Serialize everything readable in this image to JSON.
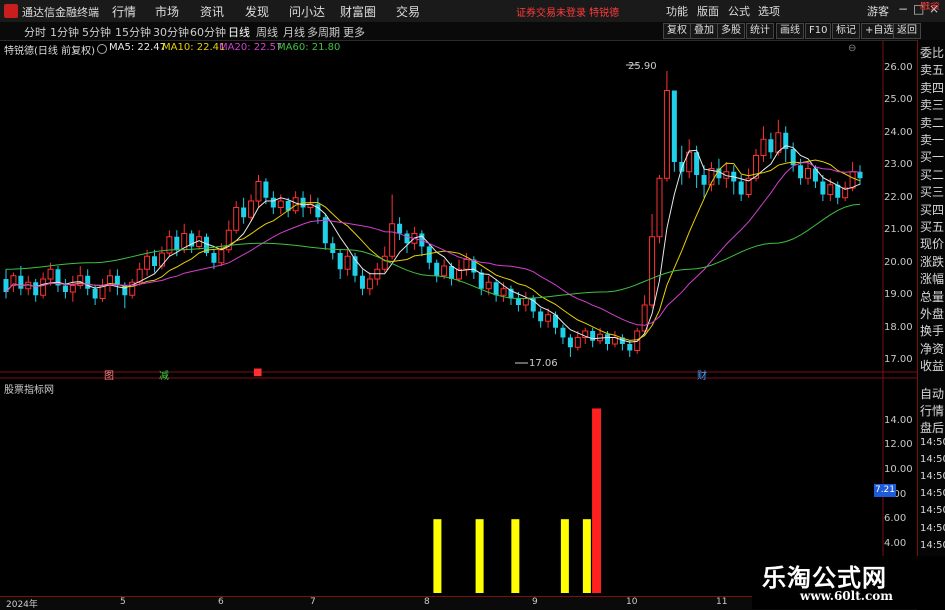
{
  "app": {
    "title": "通达信金融终端"
  },
  "menu": [
    "行情",
    "市场",
    "资讯",
    "发现",
    "问小达",
    "财富圈",
    "交易"
  ],
  "notice": "证券交易未登录 特锐德",
  "right_menu": [
    "功能",
    "版面",
    "公式",
    "选项"
  ],
  "guest_label": "游客",
  "window_buttons": {
    "minimize": "−",
    "maximize": "□",
    "close": "×"
  },
  "timeframes": [
    "分时",
    "1分钟",
    "5分钟",
    "15分钟",
    "30分钟",
    "60分钟",
    "日线",
    "周线",
    "月线",
    "多周期",
    "更多"
  ],
  "active_timeframe": "日线",
  "right_toolbar": [
    "复权",
    "叠加",
    "多股",
    "统计",
    "画线",
    "F10",
    "标记",
    "+自选",
    "返回"
  ],
  "legend": {
    "stock": "特锐德(日线 前复权)",
    "ma5": "MA5: 22.47",
    "ma10": "MA10: 22.41",
    "ma20": "MA20: 22.57",
    "ma60": "MA60: 21.80"
  },
  "colors": {
    "up": "#ff3030",
    "down": "#20d0e8",
    "ma5": "#e8e8e8",
    "ma10": "#e8d000",
    "ma20": "#d040d0",
    "ma60": "#40c040",
    "signal": "#ffff00",
    "highlight": "#ff2020",
    "frame": "#7a1010"
  },
  "price_axis": [
    "26.00",
    "25.00",
    "24.00",
    "23.00",
    "22.00",
    "21.00",
    "20.00",
    "19.00",
    "18.00",
    "17.00"
  ],
  "price_marks": {
    "high": "25.90",
    "low": "17.06"
  },
  "event_marks": [
    {
      "label": "图",
      "color": "#ff8080"
    },
    {
      "label": "减",
      "color": "#40d040"
    },
    {
      "label": "■",
      "color": "#ff3030"
    },
    {
      "label": "财",
      "color": "#40a0ff"
    }
  ],
  "indicator": {
    "title": "股票指标网",
    "axis": [
      "14.00",
      "12.00",
      "10.00",
      "8.00",
      "6.00",
      "4.00"
    ],
    "current": "7.21"
  },
  "x_axis": [
    "2024年",
    "5",
    "6",
    "7",
    "8",
    "9",
    "10",
    "11"
  ],
  "right_sidebar": {
    "top": [
      "委比",
      "卖五",
      "卖四",
      "卖三",
      "卖二",
      "卖一",
      "买一",
      "买二",
      "买三",
      "买四",
      "买五",
      "现价",
      "涨跌",
      "涨幅",
      "总量",
      "外盘",
      "换手",
      "净资",
      "收益"
    ],
    "bottom": [
      "自动",
      "行情",
      "盘后",
      "14:50",
      "14:50",
      "14:50",
      "14:50",
      "14:50",
      "14:50",
      "14:50",
      "14:50",
      "14:50"
    ],
    "small_red": "融资"
  },
  "watermark": {
    "cn": "乐淘公式网",
    "url": "www.60lt.com"
  },
  "chart_data": {
    "type": "candlestick",
    "y_range": [
      16.7,
      26.3
    ],
    "candles": [
      [
        19.5,
        19.1,
        19.8,
        18.9
      ],
      [
        19.3,
        19.6,
        19.7,
        19.1
      ],
      [
        19.6,
        19.2,
        19.9,
        19.0
      ],
      [
        19.2,
        19.4,
        19.6,
        19.0
      ],
      [
        19.4,
        19.0,
        19.5,
        18.8
      ],
      [
        19.0,
        19.5,
        19.7,
        18.9
      ],
      [
        19.5,
        19.8,
        20.0,
        19.3
      ],
      [
        19.8,
        19.3,
        19.9,
        19.1
      ],
      [
        19.3,
        19.1,
        19.5,
        18.9
      ],
      [
        19.1,
        19.3,
        19.6,
        18.8
      ],
      [
        19.3,
        19.6,
        19.9,
        19.2
      ],
      [
        19.6,
        19.2,
        19.8,
        19.0
      ],
      [
        19.2,
        18.9,
        19.3,
        18.7
      ],
      [
        18.9,
        19.3,
        19.5,
        18.8
      ],
      [
        19.3,
        19.6,
        19.8,
        19.1
      ],
      [
        19.6,
        19.3,
        19.8,
        19.0
      ],
      [
        19.3,
        19.0,
        19.4,
        18.6
      ],
      [
        19.0,
        19.4,
        19.5,
        18.9
      ],
      [
        19.4,
        19.8,
        20.0,
        19.3
      ],
      [
        19.8,
        20.2,
        20.4,
        19.6
      ],
      [
        20.2,
        19.9,
        20.4,
        19.7
      ],
      [
        19.9,
        20.3,
        20.5,
        19.8
      ],
      [
        20.3,
        20.8,
        21.0,
        20.2
      ],
      [
        20.8,
        20.4,
        21.0,
        20.2
      ],
      [
        20.4,
        20.9,
        21.2,
        20.3
      ],
      [
        20.9,
        20.5,
        21.0,
        20.3
      ],
      [
        20.5,
        20.8,
        21.0,
        20.4
      ],
      [
        20.8,
        20.3,
        20.9,
        20.2
      ],
      [
        20.3,
        20.0,
        20.4,
        19.8
      ],
      [
        20.0,
        20.4,
        20.6,
        19.9
      ],
      [
        20.4,
        21.0,
        21.3,
        20.3
      ],
      [
        21.0,
        21.7,
        21.9,
        20.9
      ],
      [
        21.7,
        21.4,
        22.0,
        21.2
      ],
      [
        21.4,
        21.9,
        22.1,
        21.3
      ],
      [
        21.9,
        22.5,
        22.7,
        21.7
      ],
      [
        22.5,
        22.0,
        22.6,
        21.8
      ],
      [
        22.0,
        21.7,
        22.2,
        21.5
      ],
      [
        21.7,
        21.9,
        22.1,
        21.5
      ],
      [
        21.9,
        21.6,
        22.0,
        21.4
      ],
      [
        21.6,
        22.0,
        22.2,
        21.5
      ],
      [
        22.0,
        21.7,
        22.2,
        21.4
      ],
      [
        21.7,
        21.8,
        22.1,
        21.5
      ],
      [
        21.8,
        21.4,
        22.0,
        21.2
      ],
      [
        21.4,
        20.6,
        21.5,
        20.4
      ],
      [
        20.6,
        20.3,
        20.8,
        20.1
      ],
      [
        20.3,
        19.8,
        20.4,
        19.5
      ],
      [
        19.8,
        20.2,
        20.4,
        19.6
      ],
      [
        20.2,
        19.6,
        20.3,
        19.4
      ],
      [
        19.6,
        19.2,
        19.8,
        19.0
      ],
      [
        19.2,
        19.5,
        19.7,
        19.0
      ],
      [
        19.5,
        19.8,
        20.0,
        19.3
      ],
      [
        19.8,
        20.2,
        20.5,
        19.7
      ],
      [
        20.2,
        21.2,
        22.1,
        20.1
      ],
      [
        21.2,
        20.9,
        21.4,
        20.7
      ],
      [
        20.9,
        20.6,
        21.0,
        20.3
      ],
      [
        20.6,
        20.9,
        21.1,
        20.4
      ],
      [
        20.9,
        20.5,
        21.0,
        20.2
      ],
      [
        20.5,
        20.0,
        20.6,
        19.8
      ],
      [
        20.0,
        19.6,
        20.1,
        19.4
      ],
      [
        19.6,
        19.9,
        20.1,
        19.5
      ],
      [
        19.9,
        19.5,
        20.0,
        19.3
      ],
      [
        19.5,
        19.8,
        20.1,
        19.4
      ],
      [
        19.8,
        20.1,
        20.3,
        19.6
      ],
      [
        20.1,
        19.7,
        20.2,
        19.5
      ],
      [
        19.7,
        19.2,
        19.8,
        19.0
      ],
      [
        19.2,
        19.4,
        19.6,
        19.0
      ],
      [
        19.4,
        19.0,
        19.5,
        18.8
      ],
      [
        19.0,
        19.2,
        19.4,
        18.8
      ],
      [
        19.2,
        18.9,
        19.3,
        18.7
      ],
      [
        18.9,
        18.7,
        19.1,
        18.5
      ],
      [
        18.7,
        18.9,
        19.1,
        18.5
      ],
      [
        18.9,
        18.5,
        19.0,
        18.3
      ],
      [
        18.5,
        18.2,
        18.6,
        18.0
      ],
      [
        18.2,
        18.4,
        18.6,
        18.0
      ],
      [
        18.4,
        18.0,
        18.5,
        17.8
      ],
      [
        18.0,
        17.7,
        18.1,
        17.5
      ],
      [
        17.7,
        17.4,
        17.8,
        17.1
      ],
      [
        17.4,
        17.7,
        17.9,
        17.3
      ],
      [
        17.7,
        17.9,
        18.0,
        17.5
      ],
      [
        17.9,
        17.6,
        18.0,
        17.4
      ],
      [
        17.6,
        17.8,
        18.0,
        17.5
      ],
      [
        17.8,
        17.5,
        17.9,
        17.3
      ],
      [
        17.5,
        17.7,
        17.9,
        17.4
      ],
      [
        17.7,
        17.5,
        17.8,
        17.3
      ],
      [
        17.5,
        17.3,
        17.6,
        17.1
      ],
      [
        17.3,
        17.9,
        18.0,
        17.2
      ],
      [
        17.9,
        18.7,
        19.0,
        17.8
      ],
      [
        18.7,
        20.8,
        21.5,
        18.6
      ],
      [
        20.8,
        22.6,
        22.7,
        20.6
      ],
      [
        22.6,
        25.3,
        25.9,
        22.5
      ],
      [
        25.3,
        23.1,
        24.4,
        22.8
      ],
      [
        23.1,
        22.8,
        23.6,
        22.4
      ],
      [
        22.8,
        23.4,
        23.8,
        22.6
      ],
      [
        23.4,
        22.7,
        23.6,
        22.3
      ],
      [
        22.7,
        22.4,
        23.0,
        22.0
      ],
      [
        22.4,
        22.9,
        23.1,
        22.2
      ],
      [
        22.9,
        22.6,
        23.2,
        22.4
      ],
      [
        22.6,
        22.8,
        23.1,
        22.3
      ],
      [
        22.8,
        22.5,
        23.0,
        22.1
      ],
      [
        22.5,
        22.1,
        22.7,
        21.9
      ],
      [
        22.1,
        22.6,
        22.9,
        22.0
      ],
      [
        22.6,
        23.3,
        23.5,
        22.5
      ],
      [
        23.3,
        23.8,
        24.2,
        23.1
      ],
      [
        23.8,
        23.4,
        24.0,
        23.2
      ],
      [
        23.4,
        24.0,
        24.4,
        23.3
      ],
      [
        24.0,
        23.5,
        24.2,
        23.1
      ],
      [
        23.5,
        23.0,
        23.7,
        22.8
      ],
      [
        23.0,
        22.6,
        23.2,
        22.4
      ],
      [
        22.6,
        22.9,
        23.1,
        22.4
      ],
      [
        22.9,
        22.5,
        23.0,
        22.3
      ],
      [
        22.5,
        22.1,
        22.7,
        21.9
      ],
      [
        22.1,
        22.4,
        22.6,
        21.9
      ],
      [
        22.4,
        22.0,
        22.5,
        21.8
      ],
      [
        22.0,
        22.3,
        22.5,
        21.9
      ],
      [
        22.3,
        22.8,
        23.1,
        22.2
      ],
      [
        22.8,
        22.6,
        23.0,
        22.4
      ]
    ],
    "ma60_anchor": [
      19.8,
      20.0,
      20.4,
      20.6,
      20.4,
      19.6,
      18.9,
      19.1,
      19.8,
      20.6,
      21.8
    ],
    "indicator_bars": [
      {
        "x_ratio": 0.477,
        "value": 6.0,
        "color": "yellow"
      },
      {
        "x_ratio": 0.523,
        "value": 6.0,
        "color": "yellow"
      },
      {
        "x_ratio": 0.562,
        "value": 6.0,
        "color": "yellow"
      },
      {
        "x_ratio": 0.616,
        "value": 6.0,
        "color": "yellow"
      },
      {
        "x_ratio": 0.64,
        "value": 6.0,
        "color": "yellow"
      },
      {
        "x_ratio": 0.65,
        "value": 15.0,
        "color": "red"
      }
    ],
    "indicator_range": [
      0,
      16.5
    ]
  }
}
